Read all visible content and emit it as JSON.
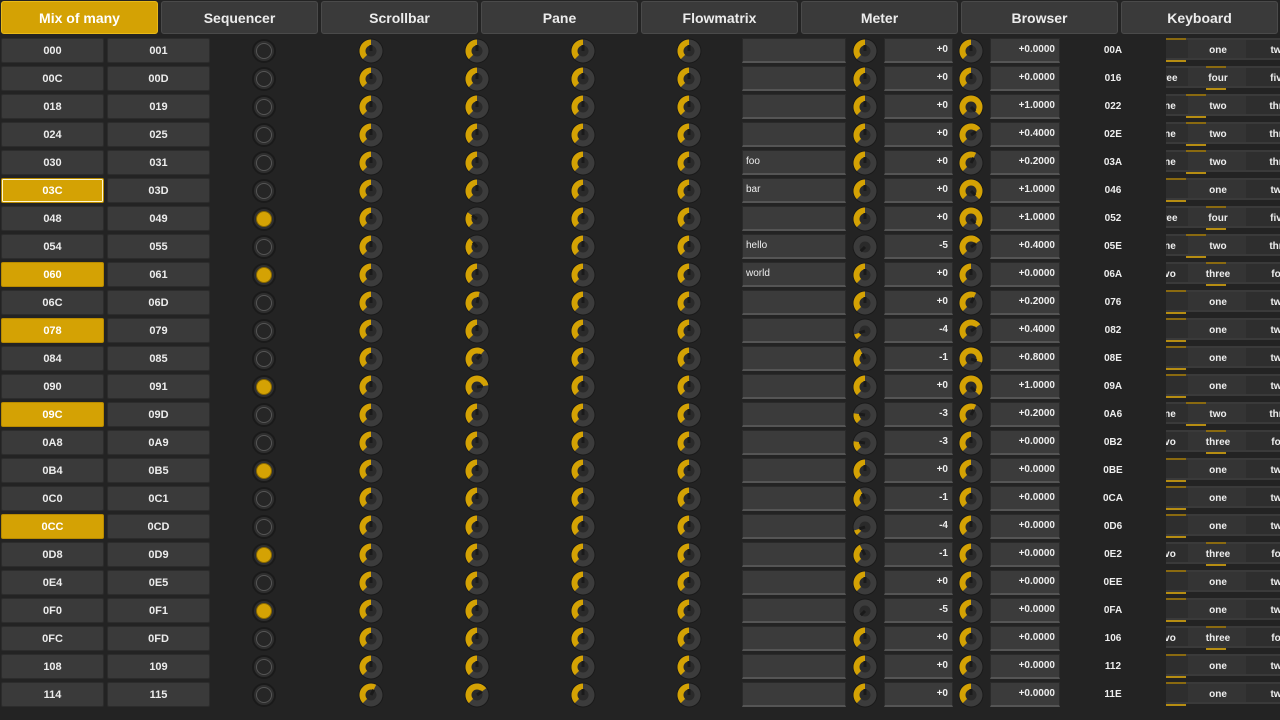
{
  "tabs": [
    {
      "label": "Mix of many",
      "active": true
    },
    {
      "label": "Sequencer",
      "active": false
    },
    {
      "label": "Scrollbar",
      "active": false
    },
    {
      "label": "Pane",
      "active": false
    },
    {
      "label": "Flowmatrix",
      "active": false
    },
    {
      "label": "Meter",
      "active": false
    },
    {
      "label": "Browser",
      "active": false
    },
    {
      "label": "Keyboard",
      "active": false
    }
  ],
  "colors": {
    "accent": "#d4a204",
    "bg": "#232323",
    "widget": "#3a3a3a"
  },
  "rows": [
    {
      "b1": "000",
      "b2": "001",
      "b1_state": "off",
      "led": false,
      "text": "",
      "int": "+0",
      "float": "+0.0000",
      "hex": "00A",
      "spin": [
        "",
        "one",
        "tw"
      ],
      "int_knob": 0.5,
      "float_knob": 0.5
    },
    {
      "b1": "00C",
      "b2": "00D",
      "b1_state": "off",
      "led": false,
      "text": "",
      "int": "+0",
      "float": "+0.0000",
      "hex": "016",
      "spin": [
        "ree",
        "four",
        "fiv"
      ],
      "int_knob": 0.5,
      "float_knob": 0.5
    },
    {
      "b1": "018",
      "b2": "019",
      "b1_state": "off",
      "led": false,
      "text": "",
      "int": "+0",
      "float": "+1.0000",
      "hex": "022",
      "spin": [
        "ne",
        "two",
        "thr"
      ],
      "int_knob": 0.5,
      "float_knob": 1.0
    },
    {
      "b1": "024",
      "b2": "025",
      "b1_state": "off",
      "led": false,
      "text": "",
      "int": "+0",
      "float": "+0.4000",
      "hex": "02E",
      "spin": [
        "ne",
        "two",
        "thr"
      ],
      "int_knob": 0.5,
      "float_knob": 0.7
    },
    {
      "b1": "030",
      "b2": "031",
      "b1_state": "off",
      "led": false,
      "text": "foo",
      "int": "+0",
      "float": "+0.2000",
      "hex": "03A",
      "spin": [
        "ne",
        "two",
        "thr"
      ],
      "int_knob": 0.5,
      "float_knob": 0.6
    },
    {
      "b1": "03C",
      "b2": "03D",
      "b1_state": "sel",
      "led": false,
      "text": "bar",
      "int": "+0",
      "float": "+1.0000",
      "hex": "046",
      "spin": [
        "",
        "one",
        "tw"
      ],
      "int_knob": 0.5,
      "float_knob": 1.0
    },
    {
      "b1": "048",
      "b2": "049",
      "b1_state": "off",
      "led": true,
      "text": "",
      "int": "+0",
      "float": "+1.0000",
      "hex": "052",
      "spin": [
        "ree",
        "four",
        "fiv"
      ],
      "int_knob": 0.5,
      "float_knob": 1.0
    },
    {
      "b1": "054",
      "b2": "055",
      "b1_state": "off",
      "led": false,
      "text": "hello",
      "int": "-5",
      "float": "+0.4000",
      "hex": "05E",
      "spin": [
        "ne",
        "two",
        "thr"
      ],
      "int_knob": 0.0,
      "float_knob": 0.7
    },
    {
      "b1": "060",
      "b2": "061",
      "b1_state": "on",
      "led": true,
      "text": "world",
      "int": "+0",
      "float": "+0.0000",
      "hex": "06A",
      "spin": [
        "vo",
        "three",
        "fo"
      ],
      "int_knob": 0.5,
      "float_knob": 0.5
    },
    {
      "b1": "06C",
      "b2": "06D",
      "b1_state": "off",
      "led": false,
      "text": "",
      "int": "+0",
      "float": "+0.2000",
      "hex": "076",
      "spin": [
        "",
        "one",
        "tw"
      ],
      "int_knob": 0.5,
      "float_knob": 0.6
    },
    {
      "b1": "078",
      "b2": "079",
      "b1_state": "on",
      "led": false,
      "text": "",
      "int": "-4",
      "float": "+0.4000",
      "hex": "082",
      "spin": [
        "",
        "one",
        "tw"
      ],
      "int_knob": 0.1,
      "float_knob": 0.7
    },
    {
      "b1": "084",
      "b2": "085",
      "b1_state": "off",
      "led": false,
      "text": "",
      "int": "-1",
      "float": "+0.8000",
      "hex": "08E",
      "spin": [
        "",
        "one",
        "tw"
      ],
      "int_knob": 0.4,
      "float_knob": 0.9
    },
    {
      "b1": "090",
      "b2": "091",
      "b1_state": "off",
      "led": true,
      "text": "",
      "int": "+0",
      "float": "+1.0000",
      "hex": "09A",
      "spin": [
        "",
        "one",
        "tw"
      ],
      "int_knob": 0.5,
      "float_knob": 1.0
    },
    {
      "b1": "09C",
      "b2": "09D",
      "b1_state": "on",
      "led": false,
      "text": "",
      "int": "-3",
      "float": "+0.2000",
      "hex": "0A6",
      "spin": [
        "ne",
        "two",
        "thr"
      ],
      "int_knob": 0.2,
      "float_knob": 0.6
    },
    {
      "b1": "0A8",
      "b2": "0A9",
      "b1_state": "off",
      "led": false,
      "text": "",
      "int": "-3",
      "float": "+0.0000",
      "hex": "0B2",
      "spin": [
        "vo",
        "three",
        "fo"
      ],
      "int_knob": 0.2,
      "float_knob": 0.5
    },
    {
      "b1": "0B4",
      "b2": "0B5",
      "b1_state": "off",
      "led": true,
      "text": "",
      "int": "+0",
      "float": "+0.0000",
      "hex": "0BE",
      "spin": [
        "",
        "one",
        "tw"
      ],
      "int_knob": 0.5,
      "float_knob": 0.5
    },
    {
      "b1": "0C0",
      "b2": "0C1",
      "b1_state": "off",
      "led": false,
      "text": "",
      "int": "-1",
      "float": "+0.0000",
      "hex": "0CA",
      "spin": [
        "",
        "one",
        "tw"
      ],
      "int_knob": 0.4,
      "float_knob": 0.5
    },
    {
      "b1": "0CC",
      "b2": "0CD",
      "b1_state": "on",
      "led": false,
      "text": "",
      "int": "-4",
      "float": "+0.0000",
      "hex": "0D6",
      "spin": [
        "",
        "one",
        "tw"
      ],
      "int_knob": 0.1,
      "float_knob": 0.5
    },
    {
      "b1": "0D8",
      "b2": "0D9",
      "b1_state": "off",
      "led": true,
      "text": "",
      "int": "-1",
      "float": "+0.0000",
      "hex": "0E2",
      "spin": [
        "vo",
        "three",
        "fo"
      ],
      "int_knob": 0.4,
      "float_knob": 0.5
    },
    {
      "b1": "0E4",
      "b2": "0E5",
      "b1_state": "off",
      "led": false,
      "text": "",
      "int": "+0",
      "float": "+0.0000",
      "hex": "0EE",
      "spin": [
        "",
        "one",
        "tw"
      ],
      "int_knob": 0.5,
      "float_knob": 0.5
    },
    {
      "b1": "0F0",
      "b2": "0F1",
      "b1_state": "off",
      "led": true,
      "text": "",
      "int": "-5",
      "float": "+0.0000",
      "hex": "0FA",
      "spin": [
        "",
        "one",
        "tw"
      ],
      "int_knob": 0.0,
      "float_knob": 0.5
    },
    {
      "b1": "0FC",
      "b2": "0FD",
      "b1_state": "off",
      "led": false,
      "text": "",
      "int": "+0",
      "float": "+0.0000",
      "hex": "106",
      "spin": [
        "vo",
        "three",
        "fo"
      ],
      "int_knob": 0.5,
      "float_knob": 0.5
    },
    {
      "b1": "108",
      "b2": "109",
      "b1_state": "off",
      "led": false,
      "text": "",
      "int": "+0",
      "float": "+0.0000",
      "hex": "112",
      "spin": [
        "",
        "one",
        "tw"
      ],
      "int_knob": 0.5,
      "float_knob": 0.5
    },
    {
      "b1": "114",
      "b2": "115",
      "b1_state": "off",
      "led": false,
      "text": "",
      "int": "+0",
      "float": "+0.0000",
      "hex": "11E",
      "spin": [
        "",
        "one",
        "tw"
      ],
      "int_knob": 0.5,
      "float_knob": 0.5
    }
  ],
  "knob_columns": [
    {
      "name": "knob-col-1",
      "values": [
        0.5,
        0.5,
        0.5,
        0.5,
        0.5,
        0.5,
        0.5,
        0.5,
        0.5,
        0.5,
        0.5,
        0.5,
        0.5,
        0.5,
        0.5,
        0.5,
        0.5,
        0.5,
        0.5,
        0.5,
        0.5,
        0.5,
        0.5,
        0.6
      ]
    },
    {
      "name": "knob-col-2",
      "values": [
        0.5,
        0.5,
        0.5,
        0.5,
        0.5,
        0.5,
        0.3,
        0.35,
        0.5,
        0.55,
        0.5,
        0.65,
        0.8,
        0.5,
        0.5,
        0.5,
        0.5,
        0.5,
        0.5,
        0.5,
        0.5,
        0.5,
        0.5,
        0.7
      ]
    },
    {
      "name": "knob-col-3",
      "values": [
        0.5,
        0.5,
        0.5,
        0.5,
        0.5,
        0.5,
        0.5,
        0.5,
        0.5,
        0.5,
        0.5,
        0.5,
        0.5,
        0.5,
        0.5,
        0.5,
        0.5,
        0.5,
        0.5,
        0.5,
        0.5,
        0.5,
        0.5,
        0.5
      ]
    },
    {
      "name": "knob-col-4",
      "values": [
        0.5,
        0.5,
        0.5,
        0.5,
        0.5,
        0.5,
        0.5,
        0.5,
        0.5,
        0.5,
        0.5,
        0.5,
        0.5,
        0.5,
        0.5,
        0.5,
        0.5,
        0.5,
        0.5,
        0.5,
        0.5,
        0.5,
        0.5,
        0.5
      ]
    }
  ]
}
